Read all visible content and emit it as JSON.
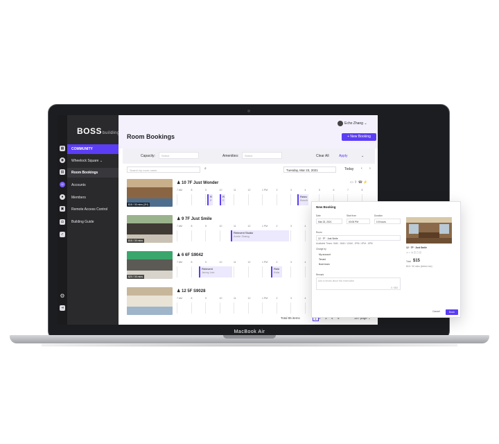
{
  "device": {
    "brand": "MacBook Air"
  },
  "app": {
    "logo_main": "BOSS",
    "logo_sub": "building",
    "page_title": "Room Bookings",
    "user_name": "Echo Zhang",
    "new_booking_label": "+ New Booking",
    "accent_color": "#5b3df5"
  },
  "sidebar": {
    "items": [
      {
        "label": "COMMUNITY",
        "icon": "grid-icon"
      },
      {
        "label": "Wheelock Square",
        "icon": "building-icon"
      },
      {
        "label": "Room Bookings",
        "icon": "calendar-icon"
      },
      {
        "label": "Accounts",
        "icon": "users-icon"
      },
      {
        "label": "Members",
        "icon": "member-icon"
      },
      {
        "label": "Remote Access Control",
        "icon": "key-icon"
      },
      {
        "label": "Building Guide",
        "icon": "book-icon"
      }
    ]
  },
  "filters": {
    "capacity_label": "Capacity:",
    "capacity_placeholder": "Select",
    "amenities_label": "Amenities:",
    "amenities_placeholder": "Select",
    "clear_all": "Clear All",
    "apply": "Apply",
    "search_placeholder": "Search by room name",
    "date": "Tuesday, Mar 23, 2021",
    "today": "Today"
  },
  "timeline_ticks": [
    "7 AM",
    "8",
    "9",
    "10",
    "11",
    "12",
    "1 PM",
    "2",
    "3",
    "4",
    "5",
    "6",
    "7",
    "8"
  ],
  "rooms": [
    {
      "capacity": "10",
      "floor": "7F",
      "name": "Just Wonder",
      "price": "$15 / 30 mins (2H)",
      "bookings": [
        {
          "title": "R",
          "sub": "E"
        },
        {
          "title": "R",
          "sub": "E"
        },
        {
          "title": "Reinv",
          "sub": "Bosch"
        }
      ]
    },
    {
      "capacity": "9",
      "floor": "7F",
      "name": "Just Smile",
      "price": "$15 / 30 mins",
      "bookings": [
        {
          "title": "Reinvent Studio",
          "sub": "Annie Zhang"
        }
      ]
    },
    {
      "capacity": "6",
      "floor": "6F",
      "name": "S9042",
      "price": "$20 / 30 mins",
      "bookings": [
        {
          "title": "Reinvent",
          "sub": "Jenny Lee"
        },
        {
          "title": "Rein",
          "sub": "Esfa"
        }
      ]
    },
    {
      "capacity": "12",
      "floor": "5F",
      "name": "S9028",
      "price": "",
      "bookings": []
    }
  ],
  "pagination": {
    "total": "Total 85 items",
    "pages": [
      "1",
      "2",
      "3",
      "4",
      "5"
    ],
    "per_page": "15 / page"
  },
  "dialog": {
    "title": "New Booking",
    "date_label": "Date",
    "date_value": "Mar 23, 2021",
    "start_label": "Start from",
    "start_value": "03:00 PM",
    "duration_label": "Duration",
    "duration_value": "0.5 hours",
    "room_label": "Room",
    "room_value": "12 · 7F · Just Smile",
    "available_times": "Available Times: 9AM - 9AM / 12AM - 2PM / 4PM - 6PM",
    "charge_label": "Charge by",
    "charge_options": [
      "My account",
      "Tenant",
      "Bosh team"
    ],
    "remark_label": "Remark",
    "remark_placeholder": "Add a remark about this reservation",
    "char_count": "0 / 500",
    "room_card_name": "Just Smile",
    "room_card_capacity": "12",
    "room_card_floor": "7F",
    "price_label": "Total",
    "price_value": "$15",
    "price_note": "$15 / 30 mins (before tax)",
    "cancel": "Cancel",
    "book": "Book"
  }
}
